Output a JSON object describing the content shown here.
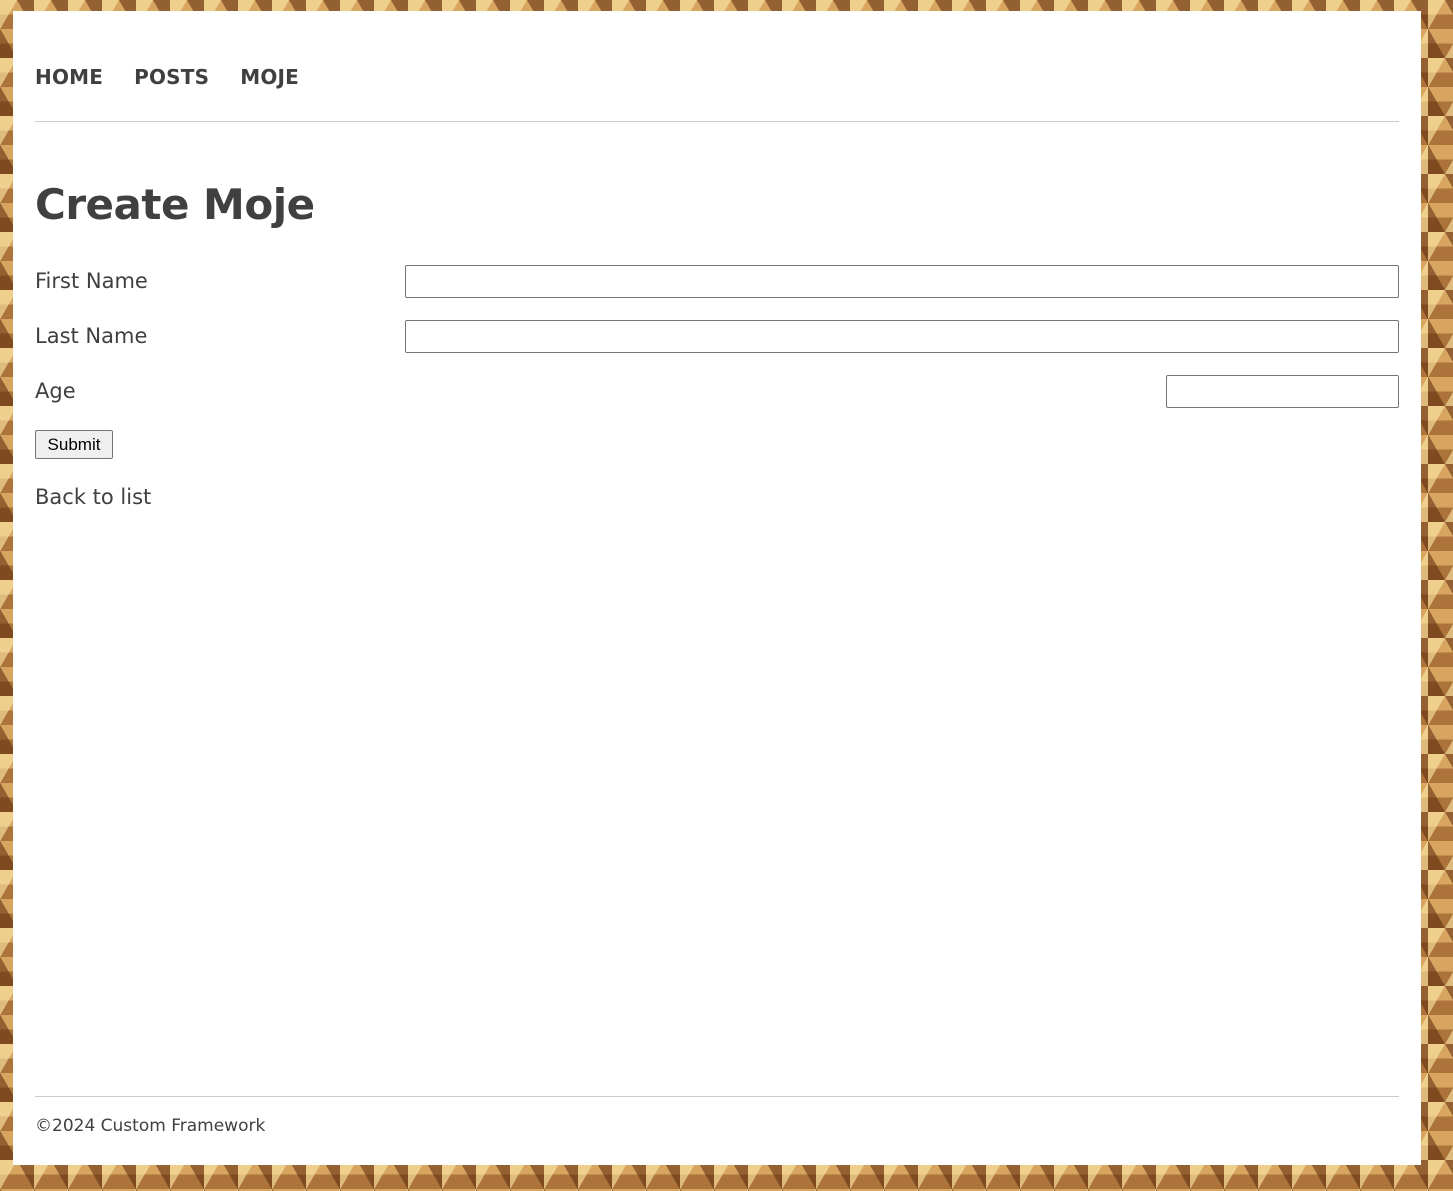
{
  "nav": {
    "items": [
      {
        "label": "HOME"
      },
      {
        "label": "POSTS"
      },
      {
        "label": "MOJE"
      }
    ]
  },
  "page": {
    "title": "Create Moje"
  },
  "form": {
    "first_name_label": "First Name",
    "first_name_value": "",
    "last_name_label": "Last Name",
    "last_name_value": "",
    "age_label": "Age",
    "age_value": "",
    "submit_label": "Submit"
  },
  "links": {
    "back_label": "Back to list"
  },
  "footer": {
    "text": "©2024 Custom Framework"
  }
}
